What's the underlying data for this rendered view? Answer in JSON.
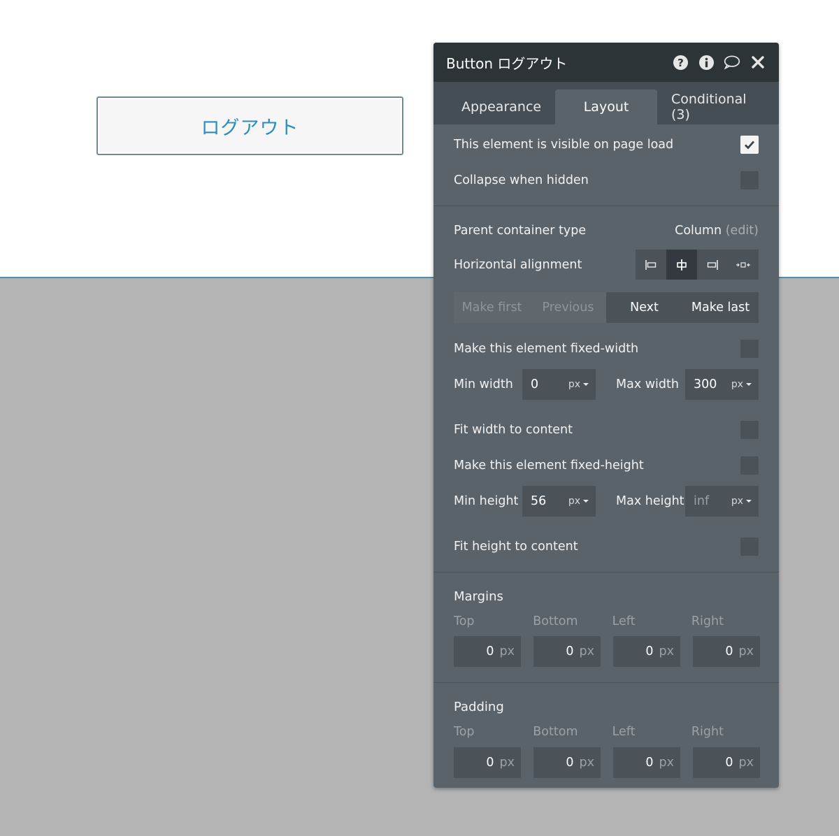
{
  "canvas": {
    "button_label": "ログアウト"
  },
  "panel": {
    "title": "Button ログアウト",
    "icons": [
      "help-icon",
      "info-icon",
      "comment-icon",
      "close-icon"
    ]
  },
  "tabs": [
    {
      "label": "Appearance",
      "active": false
    },
    {
      "label": "Layout",
      "active": true
    },
    {
      "label": "Conditional (3)",
      "active": false
    }
  ],
  "visibility": {
    "visible_on_load_label": "This element is visible on page load",
    "visible_on_load": true,
    "collapse_label": "Collapse when hidden",
    "collapse": false
  },
  "container": {
    "type_label": "Parent container type",
    "type_value": "Column",
    "edit_label": "(edit)",
    "halign_label": "Horizontal alignment",
    "halign_options": [
      "align-left-icon",
      "align-center-icon",
      "align-right-icon",
      "align-stretch-icon"
    ],
    "halign_selected": "center"
  },
  "order": {
    "make_first": "Make first",
    "previous": "Previous",
    "next": "Next",
    "make_last": "Make last"
  },
  "width": {
    "fixed_label": "Make this element fixed-width",
    "fixed": false,
    "min_label": "Min width",
    "min_value": "0",
    "min_unit": "px",
    "max_label": "Max width",
    "max_value": "300",
    "max_unit": "px",
    "fit_label": "Fit width to content",
    "fit": false
  },
  "height": {
    "fixed_label": "Make this element fixed-height",
    "fixed": false,
    "min_label": "Min height",
    "min_value": "56",
    "min_unit": "px",
    "max_label": "Max height",
    "max_value": "inf",
    "max_unit": "px",
    "fit_label": "Fit height to content",
    "fit": false
  },
  "margins": {
    "title": "Margins",
    "labels": {
      "top": "Top",
      "bottom": "Bottom",
      "left": "Left",
      "right": "Right"
    },
    "values": {
      "top": "0",
      "bottom": "0",
      "left": "0",
      "right": "0"
    },
    "unit": "px"
  },
  "padding": {
    "title": "Padding",
    "labels": {
      "top": "Top",
      "bottom": "Bottom",
      "left": "Left",
      "right": "Right"
    },
    "values": {
      "top": "0",
      "bottom": "0",
      "left": "0",
      "right": "0"
    },
    "unit": "px"
  },
  "colors": {
    "panel_bg": "#5b636a",
    "header_bg": "#2c3438",
    "tabs_bg": "#464e55",
    "field_bg": "#4b5359",
    "accent_text": "#2a8cc0"
  }
}
